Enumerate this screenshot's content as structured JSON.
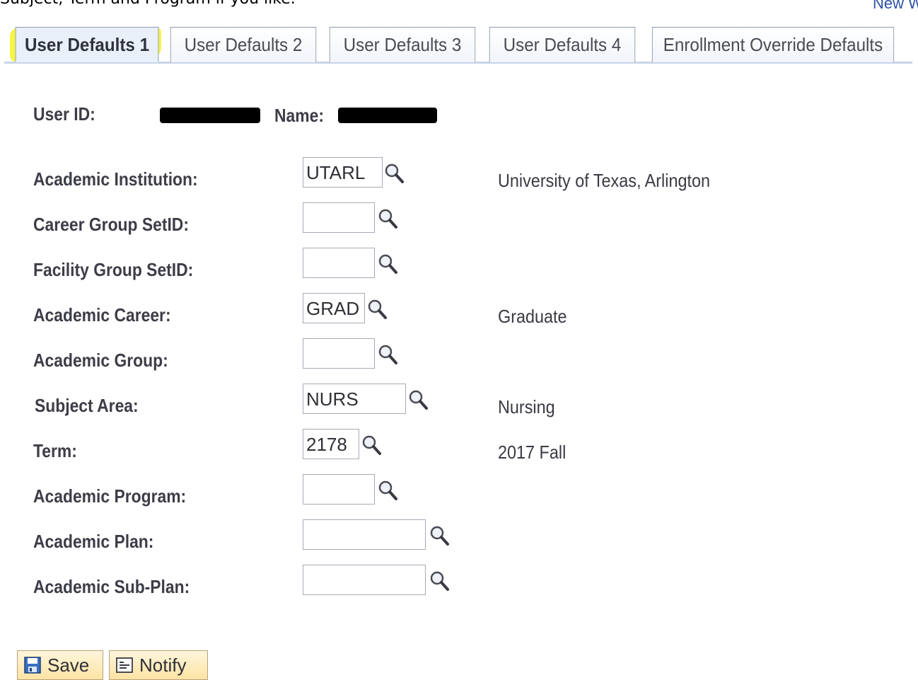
{
  "header": {
    "intro_text": "Subject, Term and Program if you like.",
    "new_window_link": "New W"
  },
  "tabs": [
    {
      "label": "User Defaults 1",
      "active": true
    },
    {
      "label": "User Defaults 2",
      "active": false
    },
    {
      "label": "User Defaults 3",
      "active": false
    },
    {
      "label": "User Defaults 4",
      "active": false
    },
    {
      "label": "Enrollment Override Defaults",
      "active": false
    }
  ],
  "user": {
    "id_label": "User ID:",
    "name_label": "Name:"
  },
  "form": {
    "rows": [
      {
        "label": "Academic Institution:",
        "value": "UTARL",
        "description": "University of Texas, Arlington"
      },
      {
        "label": "Career Group SetID:",
        "value": "",
        "description": ""
      },
      {
        "label": "Facility Group SetID:",
        "value": "",
        "description": ""
      },
      {
        "label": "Academic Career:",
        "value": "GRAD",
        "description": "Graduate"
      },
      {
        "label": "Academic Group:",
        "value": "",
        "description": ""
      },
      {
        "label": "Subject Area:",
        "value": "NURS",
        "description": "Nursing"
      },
      {
        "label": "Term:",
        "value": "2178",
        "description": "2017 Fall"
      },
      {
        "label": "Academic Program:",
        "value": "",
        "description": ""
      },
      {
        "label": "Academic Plan:",
        "value": "",
        "description": ""
      },
      {
        "label": "Academic Sub-Plan:",
        "value": "",
        "description": ""
      }
    ]
  },
  "buttons": {
    "save_label": "Save",
    "notify_label": "Notify"
  },
  "icons": {
    "lookup": "magnifier-lookup-icon",
    "save": "floppy-disk-icon",
    "notify": "notify-icon"
  },
  "colors": {
    "highlight": "#f4f43a",
    "tab_active_bg": "#eaf0f9",
    "link": "#2b52a3",
    "button_bg": "#fde3a4"
  }
}
